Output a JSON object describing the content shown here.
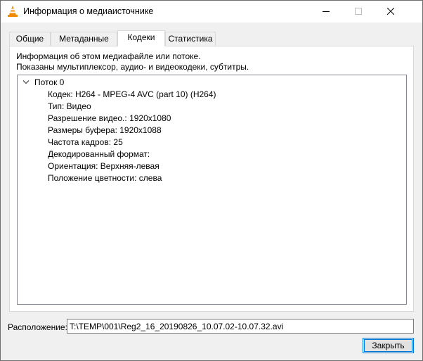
{
  "window": {
    "title": "Информация о медиаисточнике",
    "icon": "vlc-cone-icon",
    "controls": {
      "minimize": "minimize-icon",
      "maximize": "maximize-icon",
      "close": "close-icon"
    }
  },
  "tabs": [
    {
      "label": "Общие",
      "active": false
    },
    {
      "label": "Метаданные",
      "active": false
    },
    {
      "label": "Кодеки",
      "active": true
    },
    {
      "label": "Статистика",
      "active": false
    }
  ],
  "codecs": {
    "description_line1": "Информация об этом медиафайле или потоке.",
    "description_line2": "Показаны мультиплексор, аудио- и видеокодеки, субтитры.",
    "tree": {
      "stream_label": "Поток 0",
      "expanded": true,
      "items": [
        "Кодек: H264 - MPEG-4 AVC (part 10) (H264)",
        "Тип: Видео",
        "Разрешение видео.: 1920x1080",
        "Размеры буфера: 1920x1088",
        "Частота кадров: 25",
        "Декодированный формат:",
        "Ориентация: Верхняя-левая",
        "Положение цветности: слева"
      ]
    }
  },
  "location": {
    "label": "Расположение:",
    "value": "T:\\TEMP\\001\\Reg2_16_20190826_10.07.02-10.07.32.avi"
  },
  "buttons": {
    "close_label": "Закрыть"
  },
  "colors": {
    "accent": "#0078d7",
    "vlc_orange": "#f08a00"
  }
}
